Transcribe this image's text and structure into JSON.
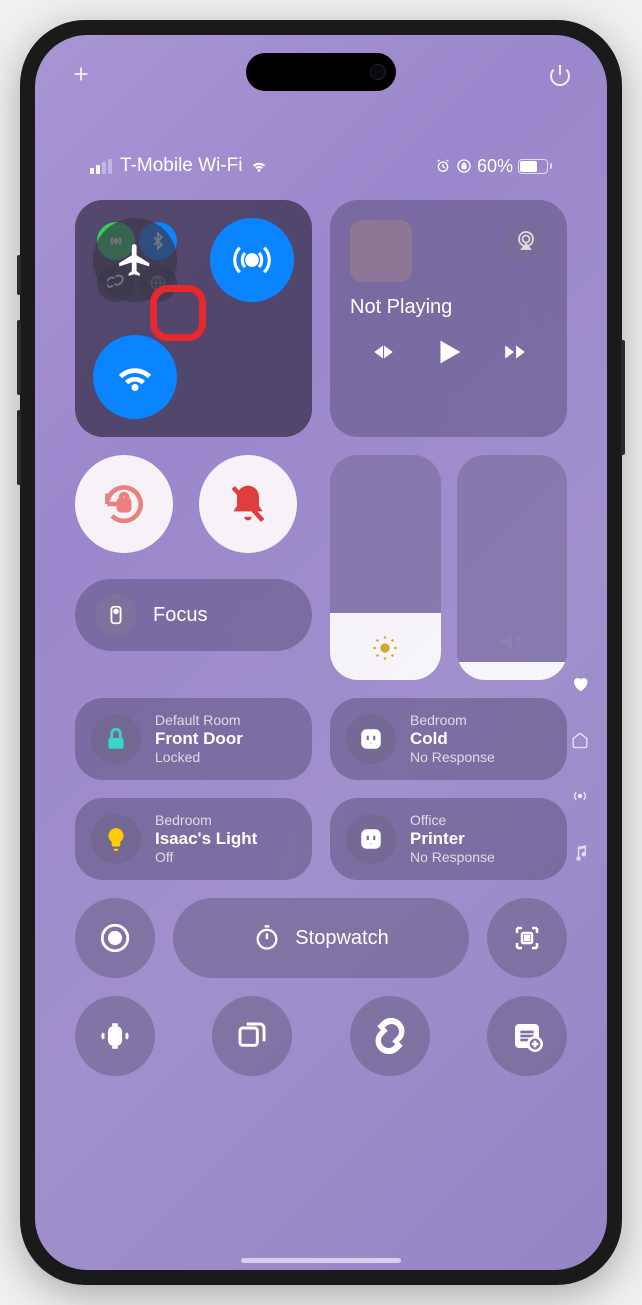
{
  "status": {
    "carrier": "T-Mobile Wi-Fi",
    "battery_percent": "60%"
  },
  "media": {
    "title": "Not Playing"
  },
  "focus": {
    "label": "Focus"
  },
  "home_tiles": [
    {
      "room": "Default Room",
      "name": "Front Door",
      "status": "Locked",
      "icon": "lock",
      "icon_color": "#3ad4c9"
    },
    {
      "room": "Bedroom",
      "name": "Cold",
      "status": "No Response",
      "icon": "outlet",
      "icon_color": "#ffffff"
    },
    {
      "room": "Bedroom",
      "name": "Isaac's Light",
      "status": "Off",
      "icon": "bulb",
      "icon_color": "#ffcc00"
    },
    {
      "room": "Office",
      "name": "Printer",
      "status": "No Response",
      "icon": "outlet",
      "icon_color": "#ffffff"
    }
  ],
  "stopwatch": {
    "label": "Stopwatch"
  },
  "sliders": {
    "brightness": 0.3,
    "volume": 0.08
  }
}
